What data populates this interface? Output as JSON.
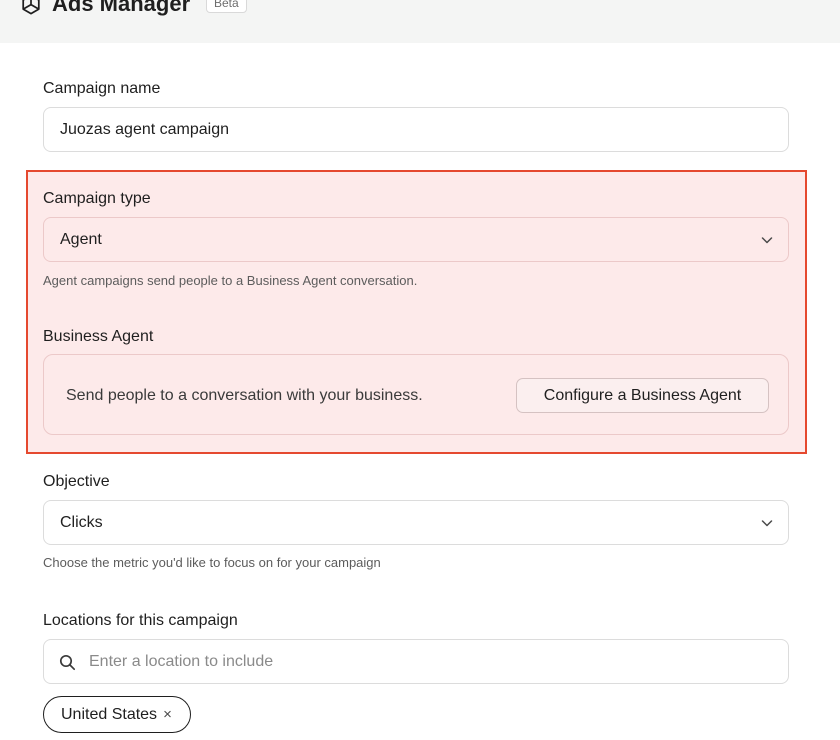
{
  "header": {
    "title": "Ads Manager",
    "badge": "Beta",
    "logo_icon": "openai-logo-icon"
  },
  "campaign_name": {
    "label": "Campaign name",
    "value": "Juozas agent campaign"
  },
  "campaign_type": {
    "label": "Campaign type",
    "value": "Agent",
    "help": "Agent campaigns send people to a Business Agent conversation."
  },
  "business_agent": {
    "label": "Business Agent",
    "description": "Send people to a conversation with your business.",
    "configure_label": "Configure a Business Agent"
  },
  "objective": {
    "label": "Objective",
    "value": "Clicks",
    "help": "Choose the metric you'd like to focus on for your campaign"
  },
  "locations": {
    "label": "Locations for this campaign",
    "placeholder": "Enter a location to include",
    "chips": [
      {
        "label": "United States",
        "remove": "×"
      }
    ]
  },
  "colors": {
    "highlight_border": "#e5492f",
    "highlight_fill": "#fdeaea",
    "header_bg": "#f4f5f4"
  }
}
